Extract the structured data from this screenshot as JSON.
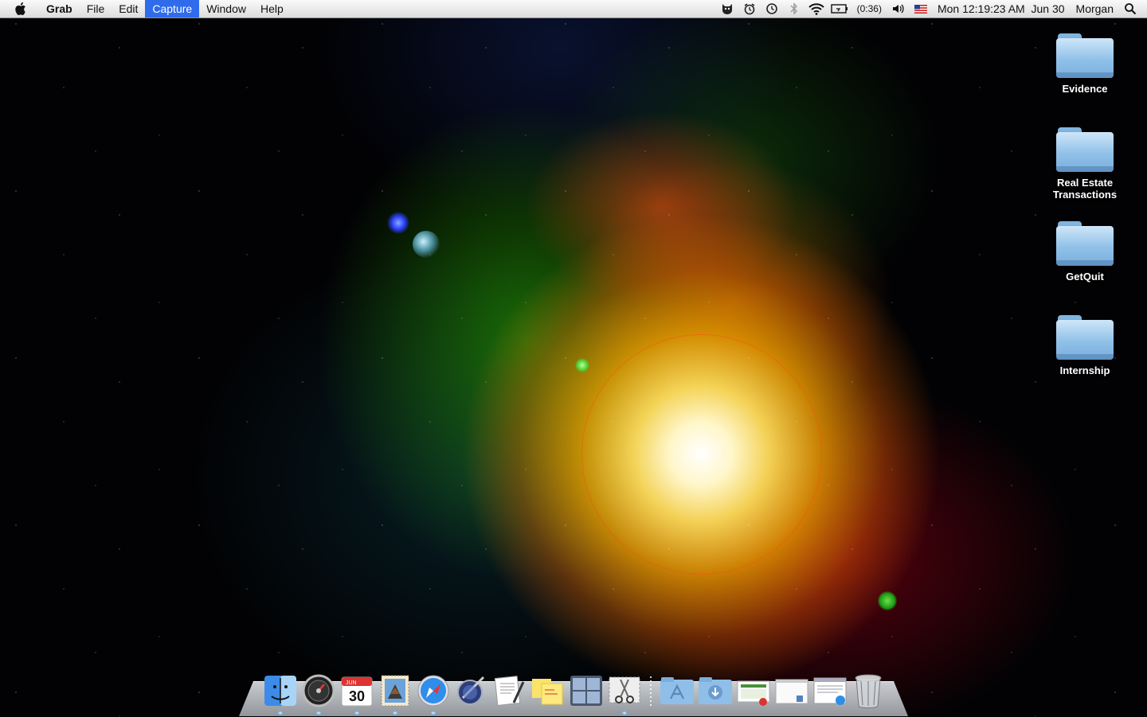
{
  "menubar": {
    "app_name": "Grab",
    "menus": [
      "File",
      "Edit",
      "Capture",
      "Window",
      "Help"
    ],
    "active_menu": "Capture",
    "status": {
      "battery_time": "(0:36)",
      "clock": "Mon 12:19:23 AM",
      "date": "Jun 30",
      "user": "Morgan"
    }
  },
  "desktop": {
    "folders": [
      {
        "name": "Evidence"
      },
      {
        "name": "Real Estate Transactions"
      },
      {
        "name": "GetQuit"
      },
      {
        "name": "Internship"
      }
    ]
  },
  "dock": {
    "calendar_date": "30",
    "calendar_month": "JUN",
    "apps": [
      "Finder",
      "Dashboard",
      "iCal",
      "Mail",
      "Safari",
      "Preview",
      "TextEdit",
      "Stickies",
      "Spaces",
      "Grab"
    ],
    "stacks": [
      "Applications",
      "Downloads",
      "Documents",
      "Screenshots",
      "Web",
      "Trash"
    ]
  },
  "colors": {
    "menu_highlight": "#2f6bea",
    "folder": "#8fc0e8"
  }
}
